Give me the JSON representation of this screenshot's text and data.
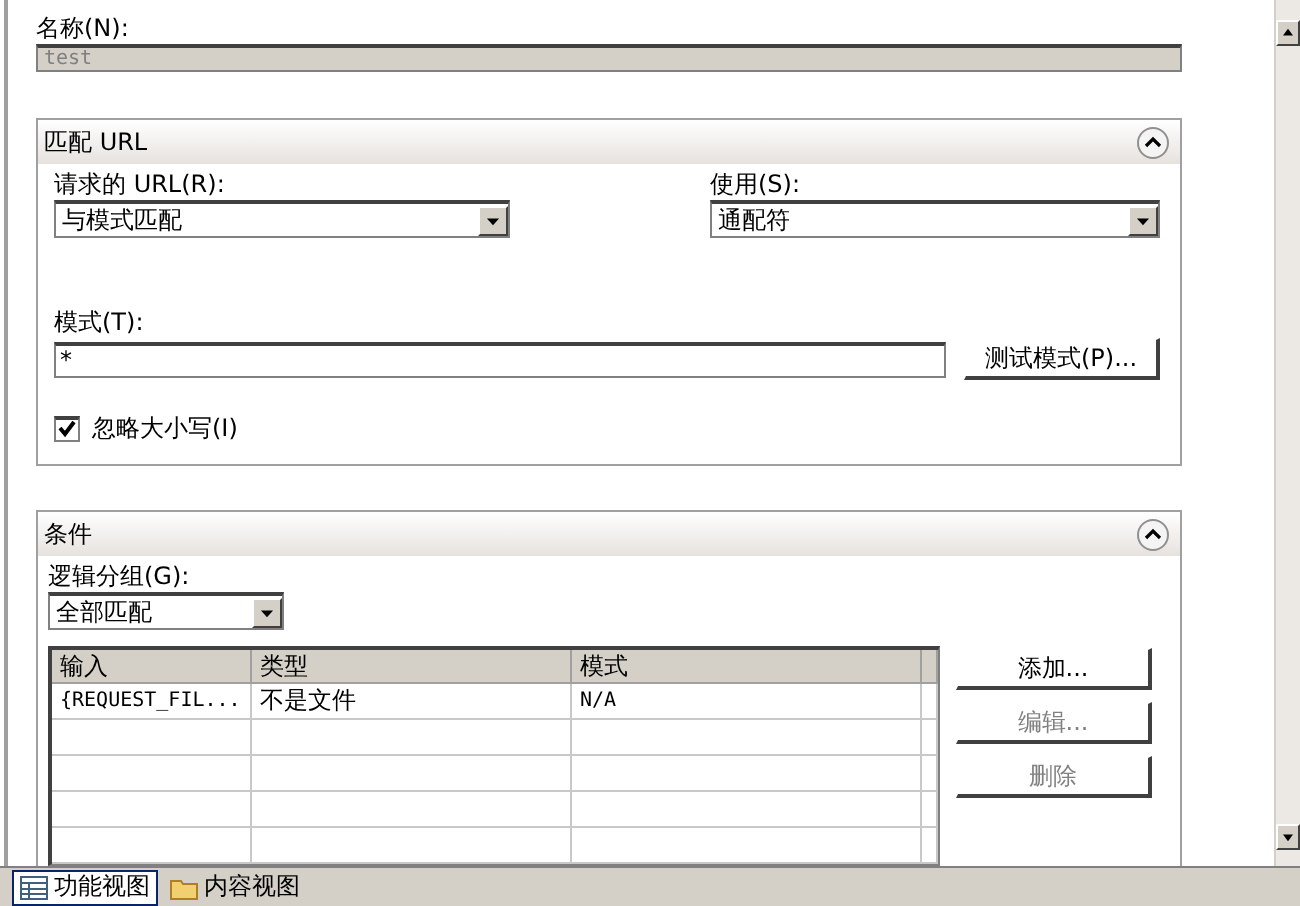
{
  "name_field": {
    "label": "名称(N):",
    "value": "test",
    "disabled": true
  },
  "url_section": {
    "title": "匹配 URL",
    "expanded": true,
    "requested": {
      "label": "请求的 URL(R):",
      "value": "与模式匹配"
    },
    "using": {
      "label": "使用(S):",
      "value": "通配符"
    },
    "pattern": {
      "label": "模式(T):",
      "value": "*"
    },
    "test_button": {
      "label": "测试模式(P)...",
      "disabled": false
    },
    "ignore_case": {
      "label": "忽略大小写(I)",
      "checked": true
    }
  },
  "conditions_section": {
    "title": "条件",
    "expanded": true,
    "grouping": {
      "label": "逻辑分组(G):",
      "value": "全部匹配"
    },
    "table": {
      "columns": [
        "输入",
        "类型",
        "模式"
      ],
      "rows": [
        {
          "cells": [
            "{REQUEST_FIL...",
            "不是文件",
            "N/A"
          ]
        }
      ]
    },
    "buttons": [
      {
        "label": "添加...",
        "disabled": false
      },
      {
        "label": "编辑...",
        "disabled": true
      },
      {
        "label": "删除",
        "disabled": true
      }
    ]
  },
  "view_tabs": [
    {
      "label": "功能视图",
      "selected": true
    },
    {
      "label": "内容视图",
      "selected": false
    }
  ]
}
